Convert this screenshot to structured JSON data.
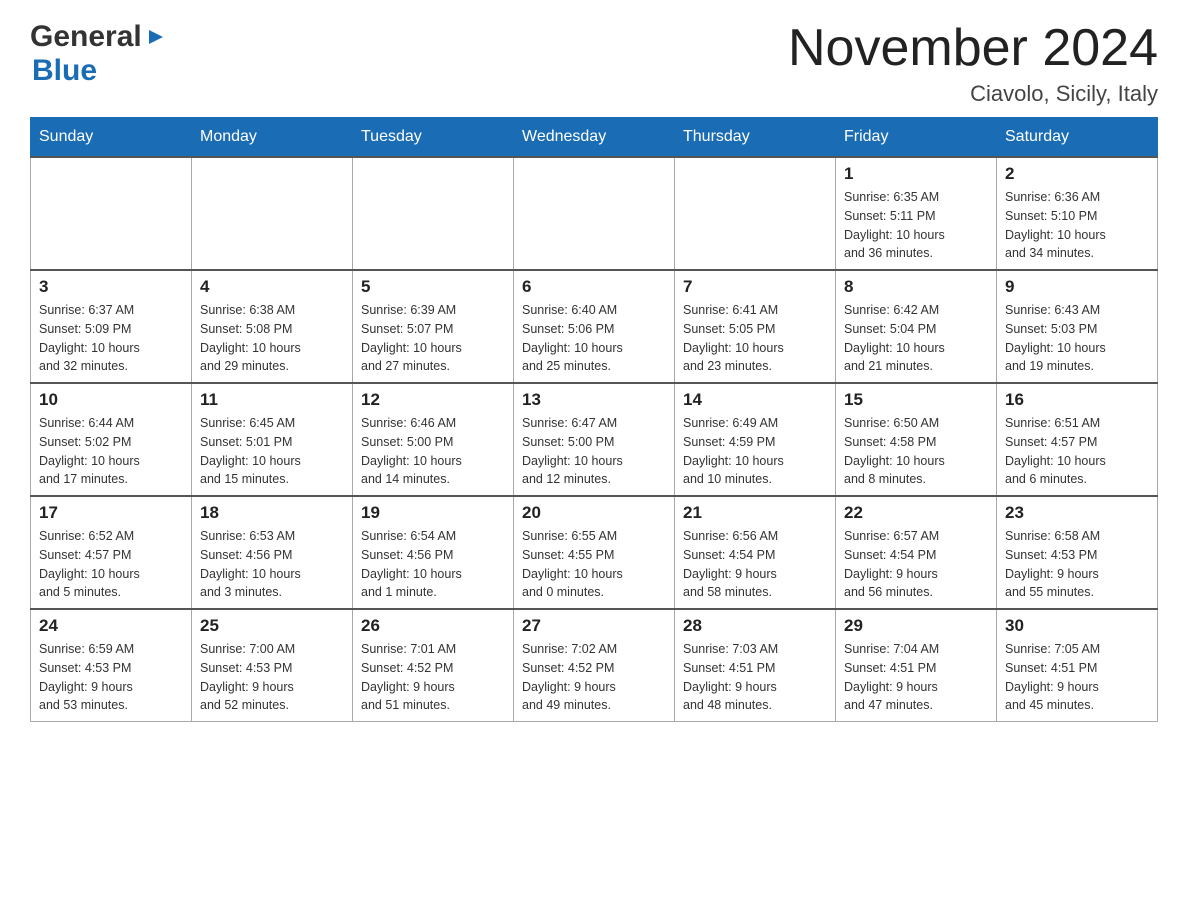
{
  "header": {
    "logo": {
      "general": "General",
      "blue": "Blue"
    },
    "title": "November 2024",
    "location": "Ciavolo, Sicily, Italy"
  },
  "weekdays": [
    "Sunday",
    "Monday",
    "Tuesday",
    "Wednesday",
    "Thursday",
    "Friday",
    "Saturday"
  ],
  "weeks": [
    [
      {
        "day": "",
        "info": ""
      },
      {
        "day": "",
        "info": ""
      },
      {
        "day": "",
        "info": ""
      },
      {
        "day": "",
        "info": ""
      },
      {
        "day": "",
        "info": ""
      },
      {
        "day": "1",
        "info": "Sunrise: 6:35 AM\nSunset: 5:11 PM\nDaylight: 10 hours\nand 36 minutes."
      },
      {
        "day": "2",
        "info": "Sunrise: 6:36 AM\nSunset: 5:10 PM\nDaylight: 10 hours\nand 34 minutes."
      }
    ],
    [
      {
        "day": "3",
        "info": "Sunrise: 6:37 AM\nSunset: 5:09 PM\nDaylight: 10 hours\nand 32 minutes."
      },
      {
        "day": "4",
        "info": "Sunrise: 6:38 AM\nSunset: 5:08 PM\nDaylight: 10 hours\nand 29 minutes."
      },
      {
        "day": "5",
        "info": "Sunrise: 6:39 AM\nSunset: 5:07 PM\nDaylight: 10 hours\nand 27 minutes."
      },
      {
        "day": "6",
        "info": "Sunrise: 6:40 AM\nSunset: 5:06 PM\nDaylight: 10 hours\nand 25 minutes."
      },
      {
        "day": "7",
        "info": "Sunrise: 6:41 AM\nSunset: 5:05 PM\nDaylight: 10 hours\nand 23 minutes."
      },
      {
        "day": "8",
        "info": "Sunrise: 6:42 AM\nSunset: 5:04 PM\nDaylight: 10 hours\nand 21 minutes."
      },
      {
        "day": "9",
        "info": "Sunrise: 6:43 AM\nSunset: 5:03 PM\nDaylight: 10 hours\nand 19 minutes."
      }
    ],
    [
      {
        "day": "10",
        "info": "Sunrise: 6:44 AM\nSunset: 5:02 PM\nDaylight: 10 hours\nand 17 minutes."
      },
      {
        "day": "11",
        "info": "Sunrise: 6:45 AM\nSunset: 5:01 PM\nDaylight: 10 hours\nand 15 minutes."
      },
      {
        "day": "12",
        "info": "Sunrise: 6:46 AM\nSunset: 5:00 PM\nDaylight: 10 hours\nand 14 minutes."
      },
      {
        "day": "13",
        "info": "Sunrise: 6:47 AM\nSunset: 5:00 PM\nDaylight: 10 hours\nand 12 minutes."
      },
      {
        "day": "14",
        "info": "Sunrise: 6:49 AM\nSunset: 4:59 PM\nDaylight: 10 hours\nand 10 minutes."
      },
      {
        "day": "15",
        "info": "Sunrise: 6:50 AM\nSunset: 4:58 PM\nDaylight: 10 hours\nand 8 minutes."
      },
      {
        "day": "16",
        "info": "Sunrise: 6:51 AM\nSunset: 4:57 PM\nDaylight: 10 hours\nand 6 minutes."
      }
    ],
    [
      {
        "day": "17",
        "info": "Sunrise: 6:52 AM\nSunset: 4:57 PM\nDaylight: 10 hours\nand 5 minutes."
      },
      {
        "day": "18",
        "info": "Sunrise: 6:53 AM\nSunset: 4:56 PM\nDaylight: 10 hours\nand 3 minutes."
      },
      {
        "day": "19",
        "info": "Sunrise: 6:54 AM\nSunset: 4:56 PM\nDaylight: 10 hours\nand 1 minute."
      },
      {
        "day": "20",
        "info": "Sunrise: 6:55 AM\nSunset: 4:55 PM\nDaylight: 10 hours\nand 0 minutes."
      },
      {
        "day": "21",
        "info": "Sunrise: 6:56 AM\nSunset: 4:54 PM\nDaylight: 9 hours\nand 58 minutes."
      },
      {
        "day": "22",
        "info": "Sunrise: 6:57 AM\nSunset: 4:54 PM\nDaylight: 9 hours\nand 56 minutes."
      },
      {
        "day": "23",
        "info": "Sunrise: 6:58 AM\nSunset: 4:53 PM\nDaylight: 9 hours\nand 55 minutes."
      }
    ],
    [
      {
        "day": "24",
        "info": "Sunrise: 6:59 AM\nSunset: 4:53 PM\nDaylight: 9 hours\nand 53 minutes."
      },
      {
        "day": "25",
        "info": "Sunrise: 7:00 AM\nSunset: 4:53 PM\nDaylight: 9 hours\nand 52 minutes."
      },
      {
        "day": "26",
        "info": "Sunrise: 7:01 AM\nSunset: 4:52 PM\nDaylight: 9 hours\nand 51 minutes."
      },
      {
        "day": "27",
        "info": "Sunrise: 7:02 AM\nSunset: 4:52 PM\nDaylight: 9 hours\nand 49 minutes."
      },
      {
        "day": "28",
        "info": "Sunrise: 7:03 AM\nSunset: 4:51 PM\nDaylight: 9 hours\nand 48 minutes."
      },
      {
        "day": "29",
        "info": "Sunrise: 7:04 AM\nSunset: 4:51 PM\nDaylight: 9 hours\nand 47 minutes."
      },
      {
        "day": "30",
        "info": "Sunrise: 7:05 AM\nSunset: 4:51 PM\nDaylight: 9 hours\nand 45 minutes."
      }
    ]
  ]
}
